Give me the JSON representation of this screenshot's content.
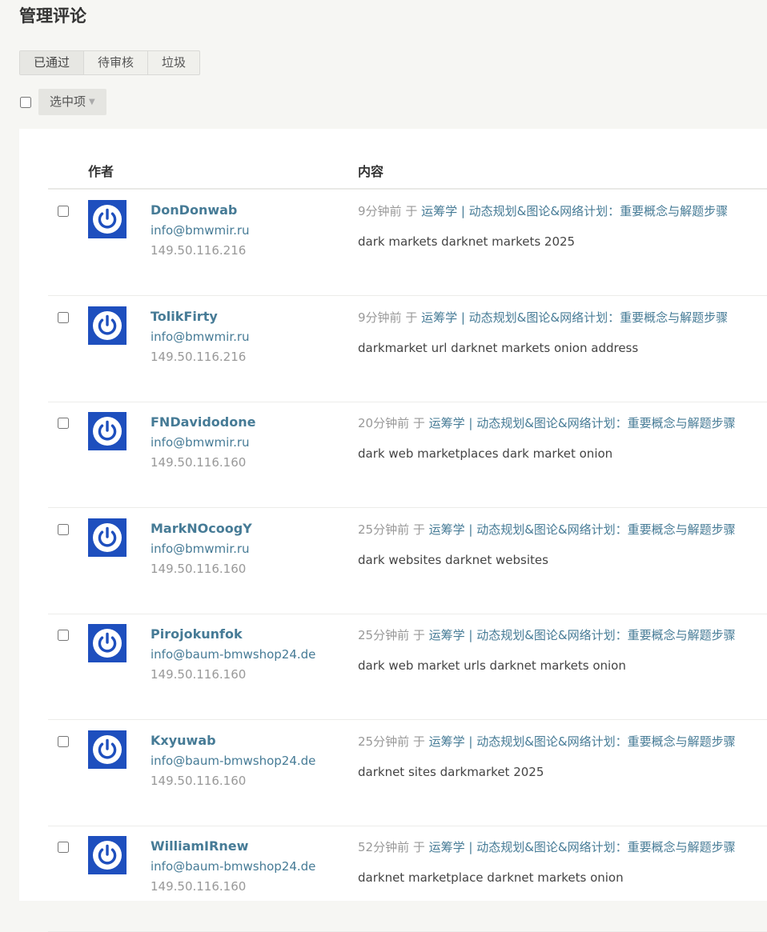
{
  "page": {
    "title": "管理评论"
  },
  "tabs": [
    {
      "label": "已通过",
      "active": true
    },
    {
      "label": "待审核",
      "active": false
    },
    {
      "label": "垃圾",
      "active": false
    }
  ],
  "bulk": {
    "button_label": "选中项",
    "caret": "▼"
  },
  "table": {
    "headers": {
      "author": "作者",
      "content": "内容"
    },
    "rows": [
      {
        "name": "DonDonwab",
        "email": "info@bmwmir.ru",
        "ip": "149.50.116.216",
        "time": "9分钟前",
        "sep": " 于 ",
        "post": "运筹学 | 动态规划&图论&网络计划：重要概念与解题步骤",
        "text": "dark markets darknet markets 2025"
      },
      {
        "name": "TolikFirty",
        "email": "info@bmwmir.ru",
        "ip": "149.50.116.216",
        "time": "9分钟前",
        "sep": " 于 ",
        "post": "运筹学 | 动态规划&图论&网络计划：重要概念与解题步骤",
        "text": "darkmarket url darknet markets onion address"
      },
      {
        "name": "FNDavidodone",
        "email": "info@bmwmir.ru",
        "ip": "149.50.116.160",
        "time": "20分钟前",
        "sep": " 于 ",
        "post": "运筹学 | 动态规划&图论&网络计划：重要概念与解题步骤",
        "text": "dark web marketplaces dark market onion"
      },
      {
        "name": "MarkNOcoogY",
        "email": "info@bmwmir.ru",
        "ip": "149.50.116.160",
        "time": "25分钟前",
        "sep": " 于 ",
        "post": "运筹学 | 动态规划&图论&网络计划：重要概念与解题步骤",
        "text": "dark websites darknet websites"
      },
      {
        "name": "Pirojokunfok",
        "email": "info@baum-bmwshop24.de",
        "ip": "149.50.116.160",
        "time": "25分钟前",
        "sep": " 于 ",
        "post": "运筹学 | 动态规划&图论&网络计划：重要概念与解题步骤",
        "text": "dark web market urls darknet markets onion"
      },
      {
        "name": "Kxyuwab",
        "email": "info@baum-bmwshop24.de",
        "ip": "149.50.116.160",
        "time": "25分钟前",
        "sep": " 于 ",
        "post": "运筹学 | 动态规划&图论&网络计划：重要概念与解题步骤",
        "text": "darknet sites darkmarket 2025"
      },
      {
        "name": "WilliamIRnew",
        "email": "info@baum-bmwshop24.de",
        "ip": "149.50.116.160",
        "time": "52分钟前",
        "sep": " 于 ",
        "post": "运筹学 | 动态规划&图论&网络计划：重要概念与解题步骤",
        "text": "darknet marketplace darknet markets onion"
      }
    ]
  },
  "colors": {
    "link": "#467b96",
    "avatar_bg": "#1e4fbe",
    "muted": "#999999"
  },
  "icons": {
    "avatar": "power-icon",
    "caret": "caret-down-icon"
  }
}
